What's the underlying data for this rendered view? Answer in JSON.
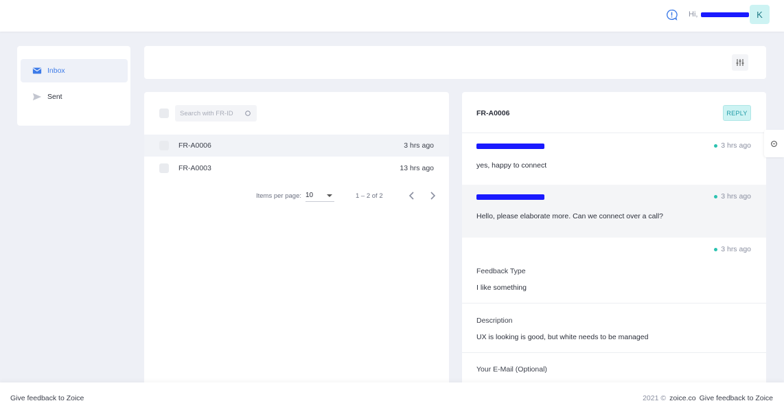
{
  "colors": {
    "accent": "#3d7be8",
    "reply_bg": "#cdf3f3",
    "status_dot": "#2bc2b0",
    "page_bg": "#eef0f6"
  },
  "header": {
    "greeting": "Hi,",
    "avatar_initial": "K",
    "alert_icon": "alert-circle-icon"
  },
  "sidebar": {
    "items": [
      {
        "label": "Inbox",
        "icon": "mail-icon",
        "active": true
      },
      {
        "label": "Sent",
        "icon": "send-icon",
        "active": false
      }
    ]
  },
  "list": {
    "search_placeholder": "Search with FR-ID",
    "rows": [
      {
        "id": "FR-A0006",
        "time": "3 hrs ago"
      },
      {
        "id": "FR-A0003",
        "time": "13 hrs ago"
      }
    ],
    "pager": {
      "items_per_page_label": "Items per page:",
      "items_per_page": "10",
      "range": "1 – 2 of 2"
    }
  },
  "detail": {
    "title": "FR-A0006",
    "reply_label": "REPLY",
    "messages": [
      {
        "time": "3 hrs ago",
        "body": "yes, happy to connect"
      },
      {
        "time": "3 hrs ago",
        "body": "Hello, please elaborate more. Can we connect over a call?"
      },
      {
        "time": "3 hrs ago"
      }
    ],
    "fields": [
      {
        "label": "Feedback Type",
        "value": "I like something"
      },
      {
        "label": "Description",
        "value": "UX is looking is good, but white needs to be managed"
      },
      {
        "label": "Your E-Mail (Optional)"
      }
    ]
  },
  "footer": {
    "left_link": "Give feedback to Zoice",
    "copyright": "2021 ©",
    "site": "zoice.co",
    "right_link": "Give feedback to Zoice"
  }
}
